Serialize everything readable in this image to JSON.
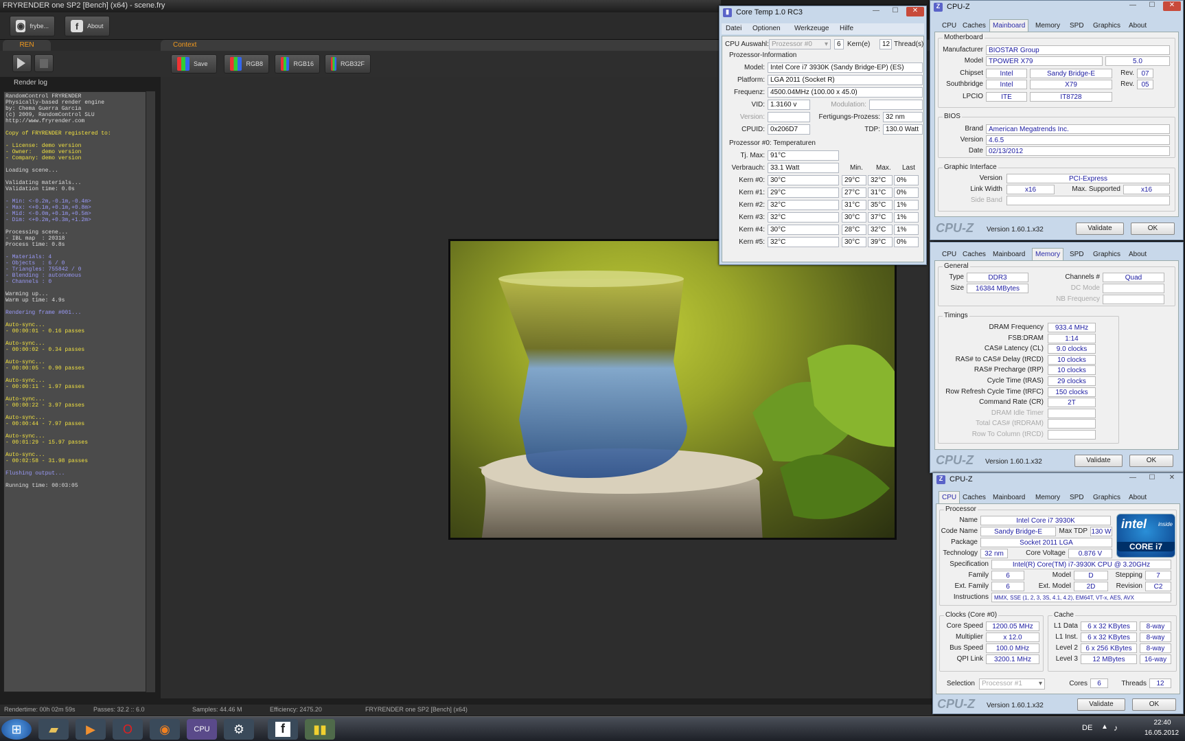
{
  "fryrender": {
    "title": "FRYRENDER one SP2 [Bench] (x64) - scene.fry",
    "toolbar": {
      "fry_label": "frybe...",
      "about_label": "About"
    },
    "tabs": {
      "ren": "REN",
      "context": "Context"
    },
    "ctx_buttons": {
      "save": "Save",
      "rgb8": "RGB8",
      "rgb16": "RGB16",
      "rgb32f": "RGB32F"
    },
    "log_label": "Render log",
    "log": [
      {
        "t": "RandomControl FRYRENDER",
        "c": "#ddd"
      },
      {
        "t": "Physically-based render engine",
        "c": "#ddd"
      },
      {
        "t": "by: Chema Guerra Garcia",
        "c": "#ddd"
      },
      {
        "t": "(c) 2009, RandomControl SLU",
        "c": "#ddd"
      },
      {
        "t": "http://www.fryrender.com",
        "c": "#ddd"
      },
      {
        "t": "",
        "c": "#ddd"
      },
      {
        "t": "Copy of FRYRENDER registered to:",
        "c": "#f0e040"
      },
      {
        "t": "",
        "c": "#ddd"
      },
      {
        "t": "- License: demo version",
        "c": "#f0e040"
      },
      {
        "t": "- Owner:   demo version",
        "c": "#f0e040"
      },
      {
        "t": "- Company: demo version",
        "c": "#f0e040"
      },
      {
        "t": "",
        "c": "#ddd"
      },
      {
        "t": "Loading scene...",
        "c": "#ddd"
      },
      {
        "t": "",
        "c": "#ddd"
      },
      {
        "t": "Validating materials...",
        "c": "#ddd"
      },
      {
        "t": "Validation time: 0.0s",
        "c": "#ddd"
      },
      {
        "t": "",
        "c": "#ddd"
      },
      {
        "t": "- Min: <-0.2m,-0.1m,-0.4m>",
        "c": "#9a9af8"
      },
      {
        "t": "- Max: <+0.1m,+0.1m,+0.8m>",
        "c": "#9a9af8"
      },
      {
        "t": "- Mid: <-0.0m,+0.1m,+0.5m>",
        "c": "#9a9af8"
      },
      {
        "t": "- Dim: <+0.2m,+0.3m,+1.2m>",
        "c": "#9a9af8"
      },
      {
        "t": "",
        "c": "#ddd"
      },
      {
        "t": "Processing scene...",
        "c": "#ddd"
      },
      {
        "t": "- IBL map  : 20318",
        "c": "#ddd"
      },
      {
        "t": "Process time: 0.8s",
        "c": "#ddd"
      },
      {
        "t": "",
        "c": "#ddd"
      },
      {
        "t": "- Materials: 4",
        "c": "#9a9af8"
      },
      {
        "t": "- Objects  : 6 / 0",
        "c": "#9a9af8"
      },
      {
        "t": "- Triangles: 755842 / 0",
        "c": "#9a9af8"
      },
      {
        "t": "- Blending : autonomous",
        "c": "#9a9af8"
      },
      {
        "t": "- Channels : 0",
        "c": "#9a9af8"
      },
      {
        "t": "",
        "c": "#ddd"
      },
      {
        "t": "Warming up...",
        "c": "#ddd"
      },
      {
        "t": "Warm up time: 4.9s",
        "c": "#ddd"
      },
      {
        "t": "",
        "c": "#ddd"
      },
      {
        "t": "Rendering frame #001...",
        "c": "#9a9af8"
      },
      {
        "t": "",
        "c": "#ddd"
      },
      {
        "t": "Auto-sync...",
        "c": "#f0e040"
      },
      {
        "t": "- 00:00:01 - 0.16 passes",
        "c": "#f0e040"
      },
      {
        "t": "",
        "c": "#ddd"
      },
      {
        "t": "Auto-sync...",
        "c": "#f0e040"
      },
      {
        "t": "- 00:00:02 - 0.34 passes",
        "c": "#f0e040"
      },
      {
        "t": "",
        "c": "#ddd"
      },
      {
        "t": "Auto-sync...",
        "c": "#f0e040"
      },
      {
        "t": "- 00:00:05 - 0.90 passes",
        "c": "#f0e040"
      },
      {
        "t": "",
        "c": "#ddd"
      },
      {
        "t": "Auto-sync...",
        "c": "#f0e040"
      },
      {
        "t": "- 00:00:11 - 1.97 passes",
        "c": "#f0e040"
      },
      {
        "t": "",
        "c": "#ddd"
      },
      {
        "t": "Auto-sync...",
        "c": "#f0e040"
      },
      {
        "t": "- 00:00:22 - 3.97 passes",
        "c": "#f0e040"
      },
      {
        "t": "",
        "c": "#ddd"
      },
      {
        "t": "Auto-sync...",
        "c": "#f0e040"
      },
      {
        "t": "- 00:00:44 - 7.97 passes",
        "c": "#f0e040"
      },
      {
        "t": "",
        "c": "#ddd"
      },
      {
        "t": "Auto-sync...",
        "c": "#f0e040"
      },
      {
        "t": "- 00:01:29 - 15.97 passes",
        "c": "#f0e040"
      },
      {
        "t": "",
        "c": "#ddd"
      },
      {
        "t": "Auto-sync...",
        "c": "#f0e040"
      },
      {
        "t": "- 00:02:58 - 31.98 passes",
        "c": "#f0e040"
      },
      {
        "t": "",
        "c": "#ddd"
      },
      {
        "t": "Flushing output...",
        "c": "#9a9af8"
      },
      {
        "t": "",
        "c": "#ddd"
      },
      {
        "t": "Running time: 00:03:05",
        "c": "#ddd"
      }
    ],
    "status": {
      "rendertime": "Rendertime: 00h 02m 59s",
      "passes": "Passes: 32.2 :: 6.0",
      "samples": "Samples: 44.46 M",
      "efficiency": "Efficiency: 2475.20",
      "app": "FRYRENDER one SP2 [Bench] (x64)"
    }
  },
  "coretemp": {
    "title": "Core Temp 1.0 RC3",
    "menu": [
      "Datei",
      "Optionen",
      "Werkzeuge",
      "Hilfe"
    ],
    "cpu_select_label": "CPU Auswahl:",
    "cpu_select_value": "Prozessor #0",
    "cores": "6",
    "cores_label": "Kern(e)",
    "threads": "12",
    "threads_label": "Thread(s)",
    "info_header": "Prozessor-Information",
    "model_label": "Model:",
    "model": "Intel Core i7 3930K (Sandy Bridge-EP)  (ES)",
    "platform_label": "Platform:",
    "platform": "LGA 2011 (Socket R)",
    "freq_label": "Frequenz:",
    "freq": "4500.04MHz (100.00 x 45.0)",
    "vid_label": "VID:",
    "vid": "1.3160 v",
    "mod_label": "Modulation:",
    "version_label": "Version:",
    "process_label": "Fertigungs-Prozess:",
    "process": "32 nm",
    "cpuid_label": "CPUID:",
    "cpuid": "0x206D7",
    "tdp_label": "TDP:",
    "tdp": "130.0 Watt",
    "temp_header": "Prozessor #0: Temperaturen",
    "tjmax_label": "Tj. Max:",
    "tjmax": "91°C",
    "power_label": "Verbrauch:",
    "power": "33.1 Watt",
    "col_min": "Min.",
    "col_max": "Max.",
    "col_last": "Last",
    "rows": [
      {
        "label": "Kern #0:",
        "temp": "30°C",
        "min": "29°C",
        "max": "32°C",
        "last": "0%"
      },
      {
        "label": "Kern #1:",
        "temp": "29°C",
        "min": "27°C",
        "max": "31°C",
        "last": "0%"
      },
      {
        "label": "Kern #2:",
        "temp": "32°C",
        "min": "31°C",
        "max": "35°C",
        "last": "1%"
      },
      {
        "label": "Kern #3:",
        "temp": "32°C",
        "min": "30°C",
        "max": "37°C",
        "last": "1%"
      },
      {
        "label": "Kern #4:",
        "temp": "30°C",
        "min": "28°C",
        "max": "32°C",
        "last": "1%"
      },
      {
        "label": "Kern #5:",
        "temp": "32°C",
        "min": "30°C",
        "max": "39°C",
        "last": "0%"
      }
    ]
  },
  "cpuz_common": {
    "title": "CPU-Z",
    "tabs": [
      "CPU",
      "Caches",
      "Mainboard",
      "Memory",
      "SPD",
      "Graphics",
      "About"
    ],
    "logo": "CPU-Z",
    "version": "Version 1.60.1.x32",
    "validate": "Validate",
    "ok": "OK"
  },
  "mainboard": {
    "grp_mb": "Motherboard",
    "manufacturer_label": "Manufacturer",
    "manufacturer": "BIOSTAR Group",
    "model_label": "Model",
    "model": "TPOWER X79",
    "model_rev": "5.0",
    "chipset_label": "Chipset",
    "chipset_v": "Intel",
    "chipset_n": "Sandy Bridge-E",
    "rev_label": "Rev.",
    "chipset_rev": "07",
    "south_label": "Southbridge",
    "south_v": "Intel",
    "south_n": "X79",
    "south_rev": "05",
    "lpcio_label": "LPCIO",
    "lpcio_v": "ITE",
    "lpcio_n": "IT8728",
    "grp_bios": "BIOS",
    "brand_label": "Brand",
    "brand": "American Megatrends Inc.",
    "version_label": "Version",
    "version": "4.6.5",
    "date_label": "Date",
    "date": "02/13/2012",
    "grp_gi": "Graphic Interface",
    "gi_version_label": "Version",
    "gi_version": "PCI-Express",
    "link_label": "Link Width",
    "link": "x16",
    "maxsup_label": "Max. Supported",
    "maxsup": "x16",
    "side_label": "Side Band"
  },
  "memory": {
    "grp_gen": "General",
    "type_label": "Type",
    "type": "DDR3",
    "channels_label": "Channels #",
    "channels": "Quad",
    "size_label": "Size",
    "size": "16384 MBytes",
    "dc_label": "DC Mode",
    "nb_label": "NB Frequency",
    "grp_tim": "Timings",
    "timings": [
      {
        "label": "DRAM Frequency",
        "value": "933.4 MHz",
        "g": false
      },
      {
        "label": "FSB:DRAM",
        "value": "1:14",
        "g": false
      },
      {
        "label": "CAS# Latency (CL)",
        "value": "9.0 clocks",
        "g": false
      },
      {
        "label": "RAS# to CAS# Delay (tRCD)",
        "value": "10 clocks",
        "g": false
      },
      {
        "label": "RAS# Precharge (tRP)",
        "value": "10 clocks",
        "g": false
      },
      {
        "label": "Cycle Time (tRAS)",
        "value": "29 clocks",
        "g": false
      },
      {
        "label": "Row Refresh Cycle Time (tRFC)",
        "value": "150 clocks",
        "g": false
      },
      {
        "label": "Command Rate (CR)",
        "value": "2T",
        "g": false
      },
      {
        "label": "DRAM Idle Timer",
        "value": "",
        "g": true
      },
      {
        "label": "Total CAS# (tRDRAM)",
        "value": "",
        "g": true
      },
      {
        "label": "Row To Column (tRCD)",
        "value": "",
        "g": true
      }
    ]
  },
  "cpu": {
    "grp_proc": "Processor",
    "name_label": "Name",
    "name": "Intel Core i7 3930K",
    "code_label": "Code Name",
    "code": "Sandy Bridge-E",
    "tdp_label": "Max TDP",
    "tdp": "130 W",
    "pkg_label": "Package",
    "pkg": "Socket 2011 LGA",
    "tech_label": "Technology",
    "tech": "32 nm",
    "volt_label": "Core Voltage",
    "volt": "0.876 V",
    "spec_label": "Specification",
    "spec": "Intel(R) Core(TM) i7-3930K CPU @ 3.20GHz",
    "family_label": "Family",
    "family": "6",
    "model_label": "Model",
    "model": "D",
    "step_label": "Stepping",
    "step": "7",
    "extfam_label": "Ext. Family",
    "extfam": "6",
    "extmod_label": "Ext. Model",
    "extmod": "2D",
    "rev_label": "Revision",
    "rev": "C2",
    "instr_label": "Instructions",
    "instr": "MMX, SSE (1, 2, 3, 3S, 4.1, 4.2), EM64T, VT-x, AES, AVX",
    "badge_brand": "intel",
    "badge_inside": "inside",
    "badge_model": "CORE i7",
    "grp_clocks": "Clocks (Core #0)",
    "cs_label": "Core Speed",
    "cs": "1200.05 MHz",
    "mult_label": "Multiplier",
    "mult": "x 12.0",
    "bus_label": "Bus Speed",
    "bus": "100.0 MHz",
    "qpi_label": "QPI Link",
    "qpi": "3200.1 MHz",
    "grp_cache": "Cache",
    "l1d_label": "L1 Data",
    "l1d": "6 x 32 KBytes",
    "l1d_w": "8-way",
    "l1i_label": "L1 Inst.",
    "l1i": "6 x 32 KBytes",
    "l1i_w": "8-way",
    "l2_label": "Level 2",
    "l2": "6 x 256 KBytes",
    "l2_w": "8-way",
    "l3_label": "Level 3",
    "l3": "12 MBytes",
    "l3_w": "16-way",
    "sel_label": "Selection",
    "sel": "Processor #1",
    "cores_label": "Cores",
    "cores": "6",
    "threads_label": "Threads",
    "threads": "12"
  },
  "taskbar": {
    "lang": "DE",
    "time": "22:40",
    "date": "16.05.2012"
  }
}
